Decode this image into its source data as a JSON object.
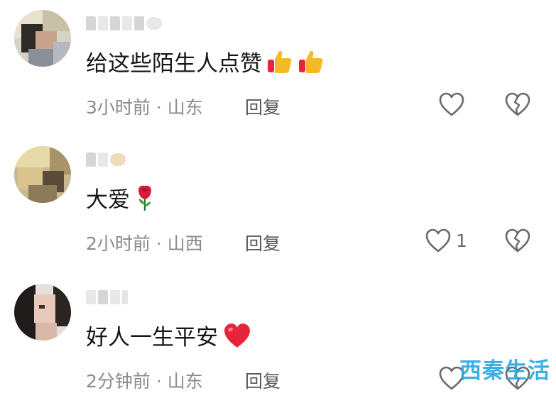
{
  "comments": [
    {
      "username": "",
      "text": "给这些陌生人点赞",
      "emojis": [
        "thumbs-up",
        "thumbs-up"
      ],
      "time": "3小时前",
      "location": "山东",
      "reply_label": "回复",
      "likes": ""
    },
    {
      "username": "",
      "text": "大爱",
      "emojis": [
        "rose"
      ],
      "time": "2小时前",
      "location": "山西",
      "reply_label": "回复",
      "likes": "1"
    },
    {
      "username": "",
      "text": "好人一生平安",
      "emojis": [
        "red-heart"
      ],
      "time": "2分钟前",
      "location": "山东",
      "reply_label": "回复",
      "likes": ""
    }
  ],
  "separator": " · ",
  "watermark": "西秦生活",
  "colors": {
    "text": "#161616",
    "meta": "#8a8a8a",
    "icon": "#6a6a6a",
    "heart": "#e8243a",
    "watermark": "#28a8df"
  }
}
